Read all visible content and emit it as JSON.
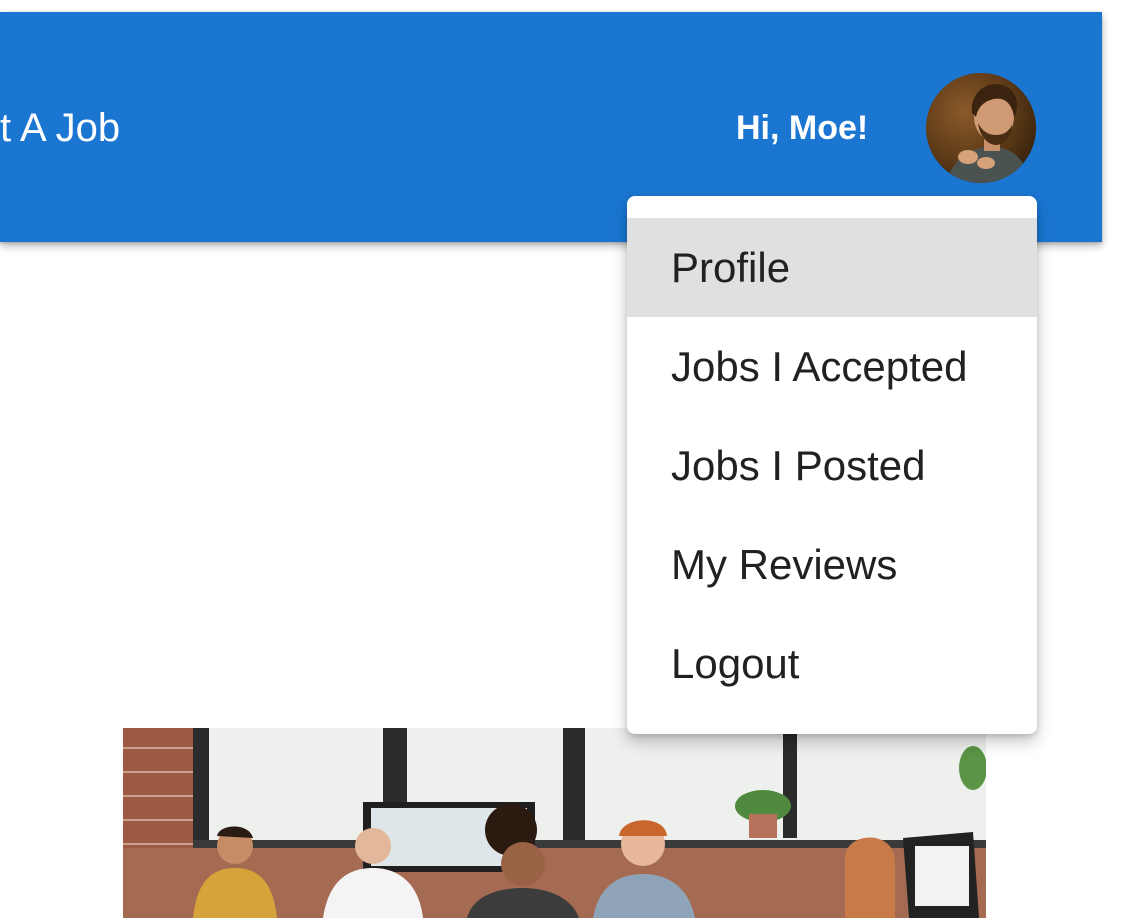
{
  "header": {
    "nav_link": "st A Job",
    "greeting": "Hi, Moe!",
    "avatar_icon": "user-avatar-photo",
    "background_color": "#1b76d2"
  },
  "user_menu": {
    "items": [
      {
        "label": "Profile",
        "active": true
      },
      {
        "label": "Jobs I Accepted",
        "active": false
      },
      {
        "label": "Jobs I Posted",
        "active": false
      },
      {
        "label": "My Reviews",
        "active": false
      },
      {
        "label": "Logout",
        "active": false
      }
    ],
    "highlight_color": "#e0e0e0"
  },
  "hero": {
    "image_subject": "office-team-photo"
  }
}
